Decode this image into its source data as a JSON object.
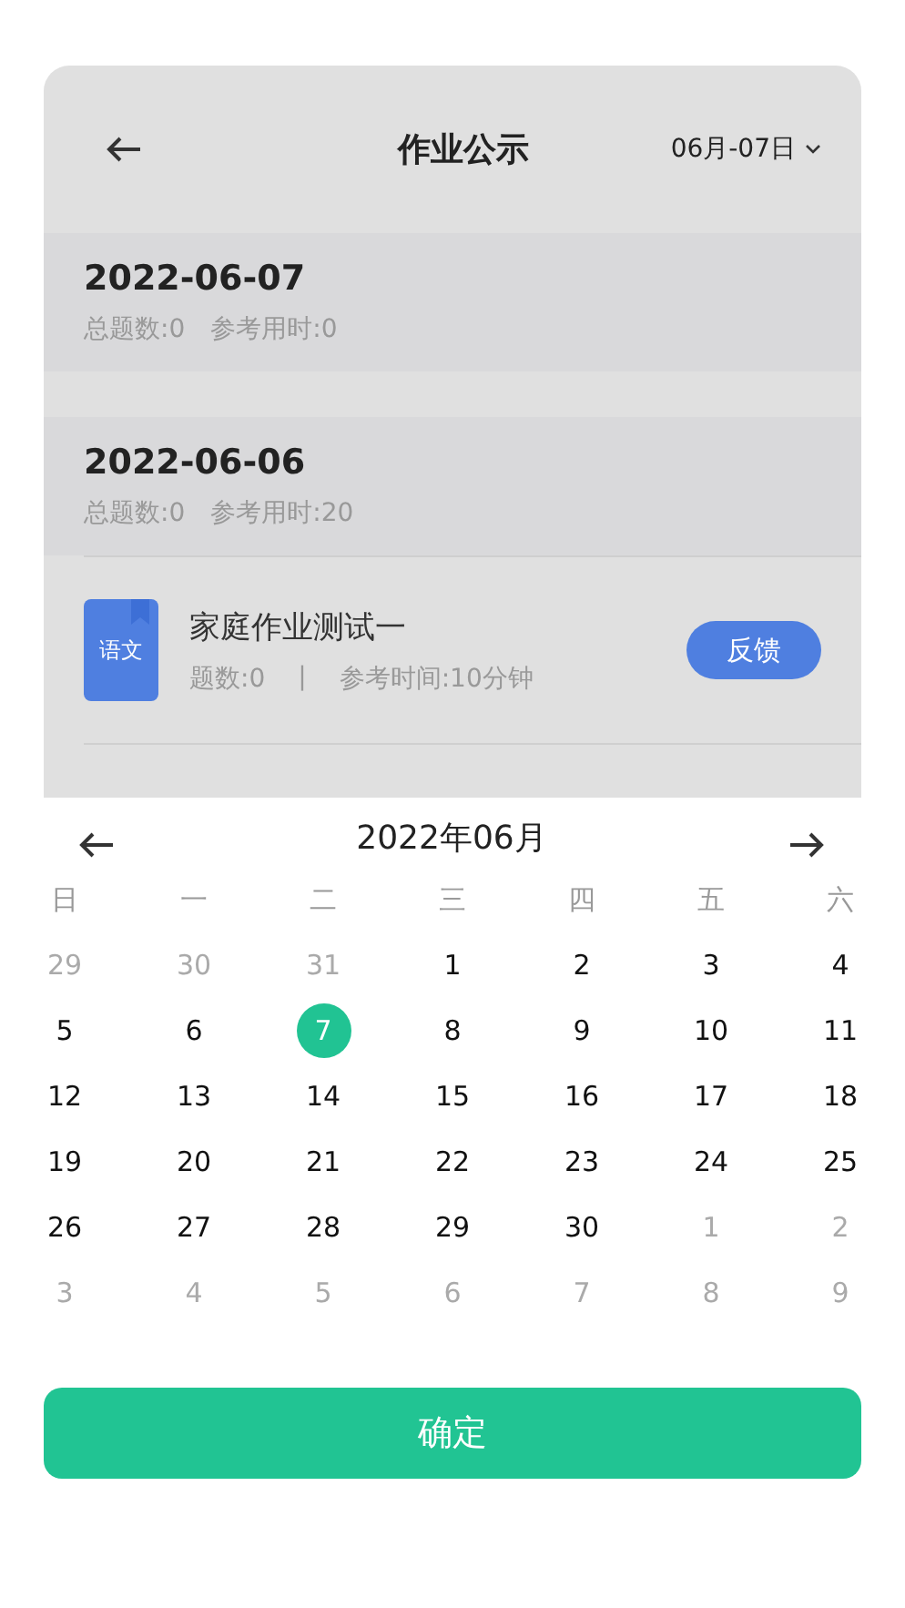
{
  "header": {
    "title": "作业公示",
    "date_range": "06月-07日"
  },
  "days": [
    {
      "date": "2022-06-07",
      "summary": [
        "总题数:0",
        "参考用时:0"
      ]
    },
    {
      "date": "2022-06-06",
      "summary": [
        "总题数:0",
        "参考用时:20"
      ],
      "items": [
        {
          "subject": "语文",
          "title": "家庭作业测试一",
          "count": "题数:0",
          "separator": "|",
          "time": "参考时间:10分钟",
          "action": "反馈"
        }
      ]
    }
  ],
  "calendar": {
    "month": "2022年06月",
    "weekdays": [
      "日",
      "一",
      "二",
      "三",
      "四",
      "五",
      "六"
    ],
    "dates": [
      {
        "day": "29",
        "current_month": false,
        "selected": false
      },
      {
        "day": "30",
        "current_month": false,
        "selected": false
      },
      {
        "day": "31",
        "current_month": false,
        "selected": false
      },
      {
        "day": "1",
        "current_month": true,
        "selected": false
      },
      {
        "day": "2",
        "current_month": true,
        "selected": false
      },
      {
        "day": "3",
        "current_month": true,
        "selected": false
      },
      {
        "day": "4",
        "current_month": true,
        "selected": false
      },
      {
        "day": "5",
        "current_month": true,
        "selected": false
      },
      {
        "day": "6",
        "current_month": true,
        "selected": false
      },
      {
        "day": "7",
        "current_month": true,
        "selected": true
      },
      {
        "day": "8",
        "current_month": true,
        "selected": false
      },
      {
        "day": "9",
        "current_month": true,
        "selected": false
      },
      {
        "day": "10",
        "current_month": true,
        "selected": false
      },
      {
        "day": "11",
        "current_month": true,
        "selected": false
      },
      {
        "day": "12",
        "current_month": true,
        "selected": false
      },
      {
        "day": "13",
        "current_month": true,
        "selected": false
      },
      {
        "day": "14",
        "current_month": true,
        "selected": false
      },
      {
        "day": "15",
        "current_month": true,
        "selected": false
      },
      {
        "day": "16",
        "current_month": true,
        "selected": false
      },
      {
        "day": "17",
        "current_month": true,
        "selected": false
      },
      {
        "day": "18",
        "current_month": true,
        "selected": false
      },
      {
        "day": "19",
        "current_month": true,
        "selected": false
      },
      {
        "day": "20",
        "current_month": true,
        "selected": false
      },
      {
        "day": "21",
        "current_month": true,
        "selected": false
      },
      {
        "day": "22",
        "current_month": true,
        "selected": false
      },
      {
        "day": "23",
        "current_month": true,
        "selected": false
      },
      {
        "day": "24",
        "current_month": true,
        "selected": false
      },
      {
        "day": "25",
        "current_month": true,
        "selected": false
      },
      {
        "day": "26",
        "current_month": true,
        "selected": false
      },
      {
        "day": "27",
        "current_month": true,
        "selected": false
      },
      {
        "day": "28",
        "current_month": true,
        "selected": false
      },
      {
        "day": "29",
        "current_month": true,
        "selected": false
      },
      {
        "day": "30",
        "current_month": true,
        "selected": false
      },
      {
        "day": "1",
        "current_month": false,
        "selected": false
      },
      {
        "day": "2",
        "current_month": false,
        "selected": false
      },
      {
        "day": "3",
        "current_month": false,
        "selected": false
      },
      {
        "day": "4",
        "current_month": false,
        "selected": false
      },
      {
        "day": "5",
        "current_month": false,
        "selected": false
      },
      {
        "day": "6",
        "current_month": false,
        "selected": false
      },
      {
        "day": "7",
        "current_month": false,
        "selected": false
      },
      {
        "day": "8",
        "current_month": false,
        "selected": false
      },
      {
        "day": "9",
        "current_month": false,
        "selected": false
      }
    ]
  },
  "confirm_button": "确定"
}
